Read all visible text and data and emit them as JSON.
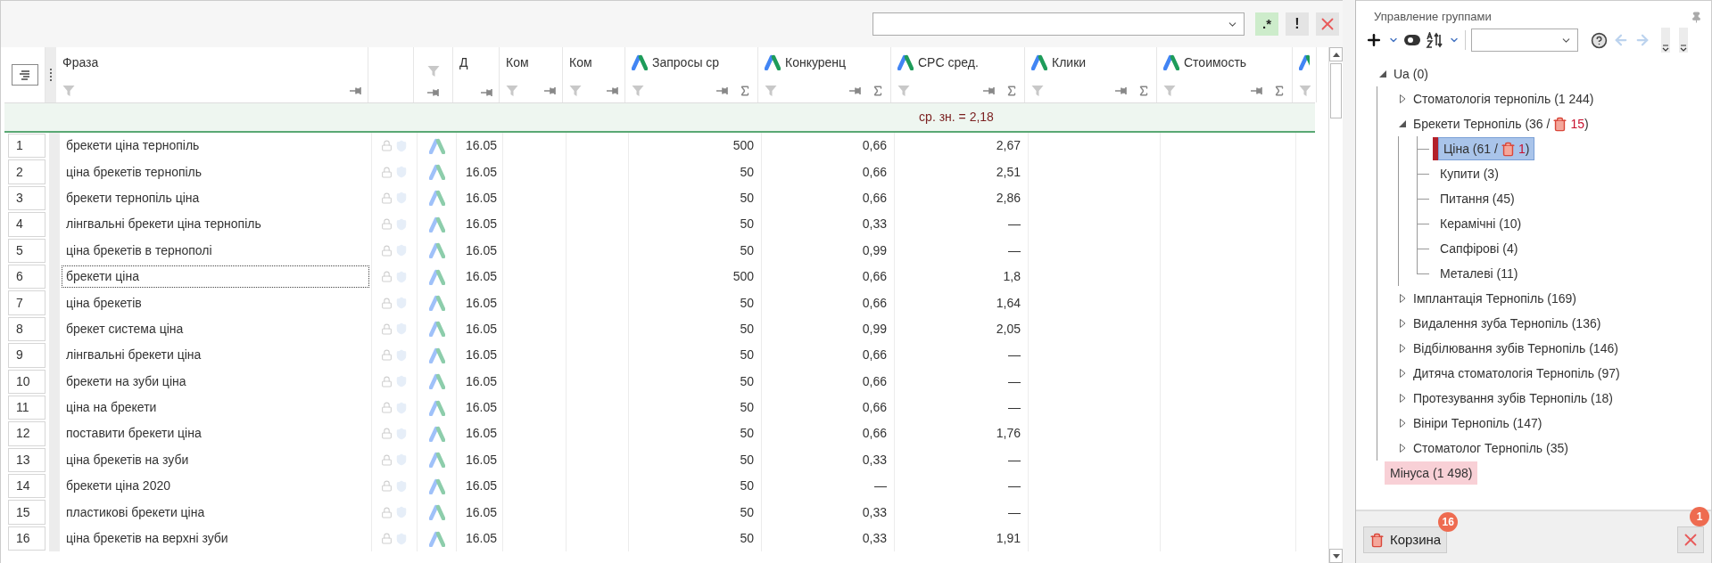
{
  "toolbar": {
    "buttons": [
      {
        "kind": "regex",
        "label": ".*",
        "on": true
      },
      {
        "kind": "exclude",
        "label": "!",
        "on": false
      },
      {
        "kind": "clear",
        "on": false
      }
    ]
  },
  "table": {
    "columns": [
      {
        "label": "Фраза",
        "kind": "text"
      },
      {
        "kind": "blank"
      },
      {
        "kind": "icon"
      },
      {
        "label": "Д",
        "kind": "date"
      },
      {
        "label": "Ком",
        "kind": "text"
      },
      {
        "label": "Ком",
        "kind": "text"
      },
      {
        "label": "Запросы ср",
        "kind": "metric"
      },
      {
        "label": "Конкуренц",
        "kind": "metric"
      },
      {
        "label": "CPC сред.",
        "kind": "metric"
      },
      {
        "label": "Клики",
        "kind": "metric"
      },
      {
        "label": "Стоимость",
        "kind": "metric"
      },
      {
        "kind": "metric_edge"
      }
    ],
    "summary": "ср. зн. = 2,18",
    "rows": [
      {
        "number": "1",
        "phrase": "брекети ціна тернопіль",
        "date": "16.05",
        "requests": "500",
        "competition": "0,66",
        "cpc": "2,67",
        "focused": false
      },
      {
        "number": "2",
        "phrase": "ціна брекетів тернопіль",
        "date": "16.05",
        "requests": "50",
        "competition": "0,66",
        "cpc": "2,51",
        "focused": false
      },
      {
        "number": "3",
        "phrase": "брекети тернопіль ціна",
        "date": "16.05",
        "requests": "50",
        "competition": "0,66",
        "cpc": "2,86",
        "focused": false
      },
      {
        "number": "4",
        "phrase": "лінгвальні брекети ціна тернопіль",
        "date": "16.05",
        "requests": "50",
        "competition": "0,33",
        "cpc": "—",
        "focused": false
      },
      {
        "number": "5",
        "phrase": "ціна брекетів в тернополі",
        "date": "16.05",
        "requests": "50",
        "competition": "0,99",
        "cpc": "—",
        "focused": false
      },
      {
        "number": "6",
        "phrase": "брекети ціна",
        "date": "16.05",
        "requests": "500",
        "competition": "0,66",
        "cpc": "1,8",
        "focused": true
      },
      {
        "number": "7",
        "phrase": "ціна брекетів",
        "date": "16.05",
        "requests": "50",
        "competition": "0,66",
        "cpc": "1,64",
        "focused": false
      },
      {
        "number": "8",
        "phrase": "брекет система ціна",
        "date": "16.05",
        "requests": "50",
        "competition": "0,99",
        "cpc": "2,05",
        "focused": false
      },
      {
        "number": "9",
        "phrase": "лінгвальні брекети ціна",
        "date": "16.05",
        "requests": "50",
        "competition": "0,66",
        "cpc": "—",
        "focused": false
      },
      {
        "number": "10",
        "phrase": "брекети на зуби ціна",
        "date": "16.05",
        "requests": "50",
        "competition": "0,66",
        "cpc": "—",
        "focused": false
      },
      {
        "number": "11",
        "phrase": "ціна на брекети",
        "date": "16.05",
        "requests": "50",
        "competition": "0,66",
        "cpc": "—",
        "focused": false
      },
      {
        "number": "12",
        "phrase": "поставити брекети ціна",
        "date": "16.05",
        "requests": "50",
        "competition": "0,66",
        "cpc": "1,76",
        "focused": false
      },
      {
        "number": "13",
        "phrase": "ціна брекетів на зуби",
        "date": "16.05",
        "requests": "50",
        "competition": "0,33",
        "cpc": "—",
        "focused": false
      },
      {
        "number": "14",
        "phrase": "брекети ціна 2020",
        "date": "16.05",
        "requests": "50",
        "competition": "—",
        "cpc": "—",
        "focused": false
      },
      {
        "number": "15",
        "phrase": "пластикові брекети ціна",
        "date": "16.05",
        "requests": "50",
        "competition": "0,33",
        "cpc": "—",
        "focused": false
      },
      {
        "number": "16",
        "phrase": "ціна брекетів на верхні зуби",
        "date": "16.05",
        "requests": "50",
        "competition": "0,33",
        "cpc": "1,91",
        "focused": false
      }
    ]
  },
  "groups_panel": {
    "title": "Управление группами",
    "tree": [
      {
        "label": "Ua (0)",
        "kind": "group",
        "expanded": true,
        "selected": false,
        "children": [
          {
            "label": "Стоматологія тернопіль (1 244)",
            "kind": "group",
            "expanded": false,
            "selected": false
          },
          {
            "label": "Брекети Тернопіль (36 /",
            "trash_count": "15",
            "suffix": ")",
            "kind": "group",
            "expanded": true,
            "selected": false,
            "children": [
              {
                "label": "Ціна (61 /",
                "trash_count": "1",
                "suffix": ")",
                "kind": "group",
                "selected": true,
                "flagged": true
              },
              {
                "label": "Купити (3)",
                "kind": "group",
                "selected": false,
                "flagged": false
              },
              {
                "label": "Питання (45)",
                "kind": "group",
                "selected": false,
                "flagged": false
              },
              {
                "label": "Керамічні (10)",
                "kind": "group",
                "selected": false,
                "flagged": false
              },
              {
                "label": "Сапфірові (4)",
                "kind": "group",
                "selected": false,
                "flagged": false
              },
              {
                "label": "Металеві (11)",
                "kind": "group",
                "selected": false,
                "flagged": false
              }
            ]
          },
          {
            "label": "Імплантація Тернопіль (169)",
            "kind": "group",
            "expanded": false,
            "selected": false
          },
          {
            "label": "Видалення зуба Тернопіль (136)",
            "kind": "group",
            "expanded": false,
            "selected": false
          },
          {
            "label": "Відбілювання зубів Тернопіль (146)",
            "kind": "group",
            "expanded": false,
            "selected": false
          },
          {
            "label": "Дитяча стоматологія Тернопіль (97)",
            "kind": "group",
            "expanded": false,
            "selected": false
          },
          {
            "label": "Протезування зубів Тернопіль (18)",
            "kind": "group",
            "expanded": false,
            "selected": false
          },
          {
            "label": "Вініри Тернопіль (147)",
            "kind": "group",
            "expanded": false,
            "selected": false
          },
          {
            "label": "Стоматолог Тернопіль (35)",
            "kind": "group",
            "expanded": false,
            "selected": false
          }
        ]
      },
      {
        "label": "Мінуса (1 498)",
        "kind": "minus",
        "selected": false
      }
    ],
    "trash_button": {
      "label": "Корзина",
      "badge": "16"
    },
    "clear_button": {
      "badge": "1"
    }
  }
}
